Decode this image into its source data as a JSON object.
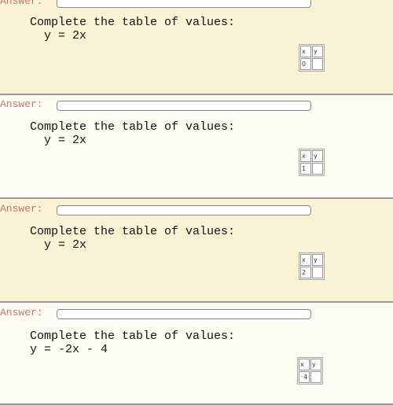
{
  "answer_label": "Answer:",
  "problems": [
    {
      "prompt": "Complete the table of values:",
      "equation": "  y = 2x",
      "table": {
        "headers": [
          "x",
          "y"
        ],
        "x": "0",
        "y": ""
      },
      "answer": ""
    },
    {
      "prompt": "Complete the table of values:",
      "equation": "  y = 2x",
      "table": {
        "headers": [
          "x",
          "y"
        ],
        "x": "1",
        "y": ""
      },
      "answer": ""
    },
    {
      "prompt": "Complete the table of values:",
      "equation": "  y = 2x",
      "table": {
        "headers": [
          "x",
          "y"
        ],
        "x": "2",
        "y": ""
      },
      "answer": ""
    },
    {
      "prompt": "Complete the table of values:",
      "equation": "y = -2x - 4",
      "table": {
        "headers": [
          "x",
          "y"
        ],
        "x": "⁻4",
        "y": ""
      },
      "answer": ""
    }
  ],
  "colors": {
    "yellow_bg": "#faf3d3",
    "white_bg": "#fdfbf3",
    "answer_label": "#c47a6e"
  }
}
